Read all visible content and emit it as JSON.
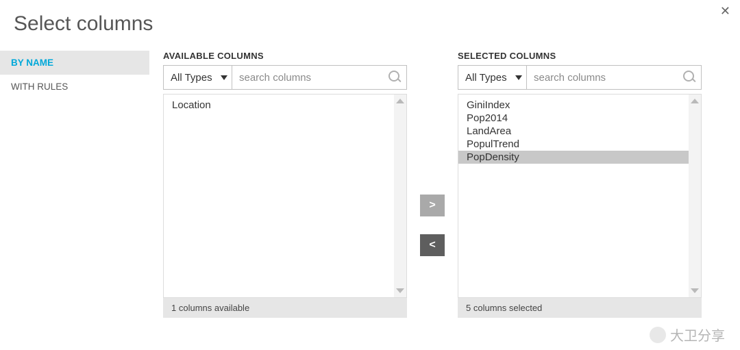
{
  "title": "Select columns",
  "sidebar": {
    "items": [
      {
        "label": "BY NAME",
        "active": true
      },
      {
        "label": "WITH RULES",
        "active": false
      }
    ]
  },
  "available": {
    "header": "AVAILABLE COLUMNS",
    "type_label": "All Types",
    "search_placeholder": "search columns",
    "items": [
      {
        "label": "Location",
        "selected": false
      }
    ],
    "footer": "1 columns available"
  },
  "selected": {
    "header": "SELECTED COLUMNS",
    "type_label": "All Types",
    "search_placeholder": "search columns",
    "items": [
      {
        "label": "GiniIndex",
        "selected": false
      },
      {
        "label": "Pop2014",
        "selected": false
      },
      {
        "label": "LandArea",
        "selected": false
      },
      {
        "label": "PopulTrend",
        "selected": false
      },
      {
        "label": "PopDensity",
        "selected": true
      }
    ],
    "footer": "5 columns selected"
  },
  "mover": {
    "add": ">",
    "remove": "<"
  },
  "watermark": "大卫分享"
}
